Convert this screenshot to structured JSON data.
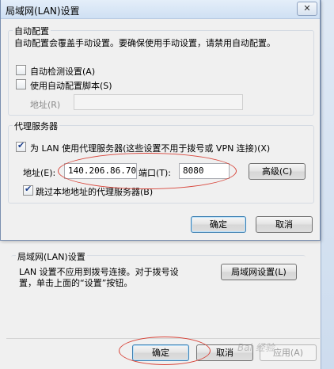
{
  "lan_dialog": {
    "title": "局域网(LAN)设置",
    "close_label": "✕",
    "auto_config": {
      "group_label": "自动配置",
      "description": "自动配置会覆盖手动设置。要确保使用手动设置，请禁用自动配置。",
      "auto_detect_label": "自动检测设置(A)",
      "auto_detect_checked": false,
      "use_script_label": "使用自动配置脚本(S)",
      "use_script_checked": false,
      "address_label": "地址(R)",
      "address_value": ""
    },
    "proxy": {
      "group_label": "代理服务器",
      "use_proxy_label": "为 LAN 使用代理服务器(这些设置不用于拨号或 VPN 连接)(X)",
      "use_proxy_checked": true,
      "address_label": "地址(E):",
      "address_value": "140.206.86.70",
      "port_label": "端口(T):",
      "port_value": "8080",
      "advanced_label": "高级(C)",
      "bypass_label": "跳过本地地址的代理服务器(B)",
      "bypass_checked": true
    },
    "ok_label": "确定",
    "cancel_label": "取消"
  },
  "parent_dialog": {
    "lan_group_label": "局域网(LAN)设置",
    "lan_description_line1": "LAN 设置不应用到拨号连接。对于拨号设",
    "lan_description_line2": "置，单击上面的“设置”按钮。",
    "lan_settings_button": "局域网设置(L)",
    "ok_label": "确定",
    "cancel_label": "取消",
    "apply_label": "应用(A)"
  },
  "watermark": "Bai 经验"
}
